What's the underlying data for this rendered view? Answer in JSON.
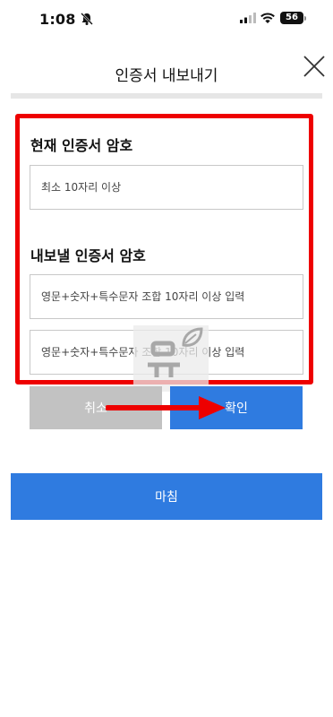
{
  "status_bar": {
    "time": "1:08",
    "battery": "56"
  },
  "header": {
    "title": "인증서 내보내기"
  },
  "current_password": {
    "label": "현재 인증서 암호",
    "placeholder": "최소 10자리 이상"
  },
  "export_password": {
    "label": "내보낼 인증서 암호",
    "placeholder": "영문+숫자+특수문자 조합 10자리 이상 입력",
    "confirm_placeholder": "영문+숫자+특수문자 조합 10자리 이상 입력"
  },
  "buttons": {
    "cancel": "취소",
    "confirm": "확인",
    "finish": "마침"
  },
  "colors": {
    "accent": "#2f7be0",
    "highlight": "#ee0000",
    "cancel": "#c2c2c2"
  },
  "icons": {
    "close": "close-icon",
    "bell": "bell-slash-icon",
    "arrow": "arrow-right-icon"
  }
}
